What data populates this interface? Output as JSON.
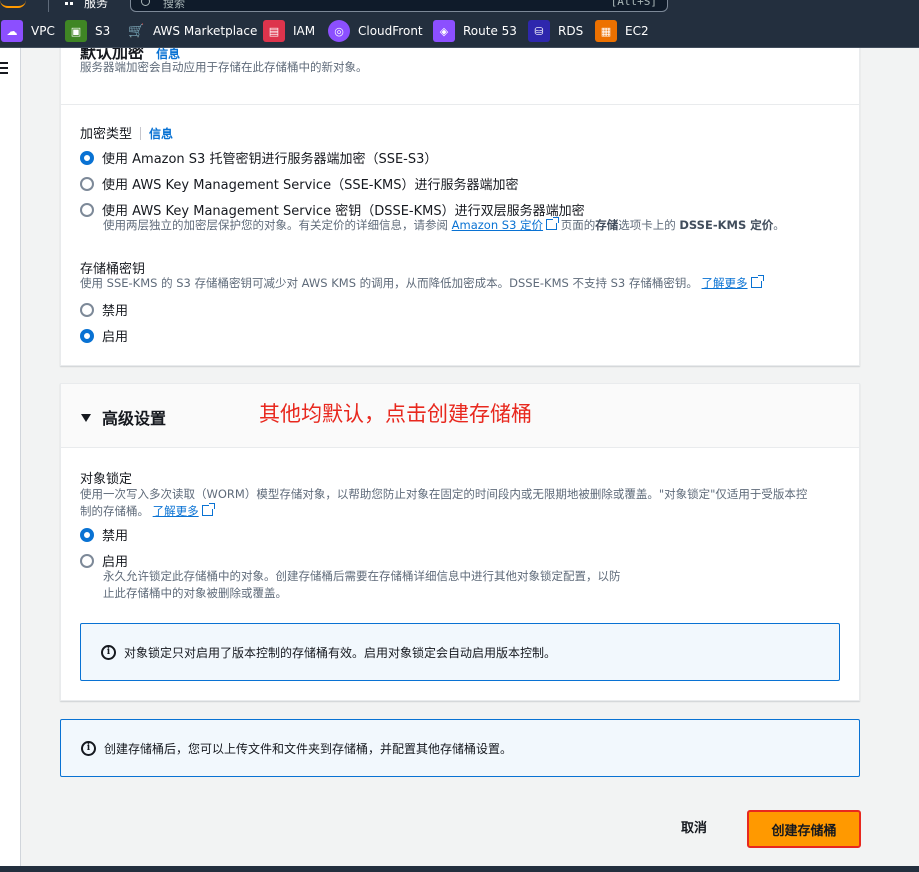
{
  "topbar": {
    "services_label": "服务",
    "search_placeholder": "搜索",
    "search_shortcut": "[Alt+S]"
  },
  "favorites": [
    {
      "label": "VPC",
      "icon": "vpc-icon",
      "color": "#8c4fff"
    },
    {
      "label": "S3",
      "icon": "s3-bucket-icon",
      "color": "#3f8624"
    },
    {
      "label": "AWS Marketplace",
      "icon": "marketplace-cart-icon",
      "color": "#232f3e"
    },
    {
      "label": "IAM",
      "icon": "iam-icon",
      "color": "#dd344c"
    },
    {
      "label": "CloudFront",
      "icon": "cloudfront-icon",
      "color": "#8c4fff"
    },
    {
      "label": "Route 53",
      "icon": "route53-icon",
      "color": "#8c4fff"
    },
    {
      "label": "RDS",
      "icon": "rds-icon",
      "color": "#2e27ad"
    },
    {
      "label": "EC2",
      "icon": "ec2-icon",
      "color": "#ed7100"
    }
  ],
  "encryption": {
    "title": "默认加密",
    "info": "信息",
    "description": "服务器端加密会自动应用于存储在此存储桶中的新对象。",
    "type_label": "加密类型",
    "type_info": "信息",
    "options": [
      {
        "label": "使用 Amazon S3 托管密钥进行服务器端加密（SSE-S3）",
        "checked": true
      },
      {
        "label": "使用 AWS Key Management Service（SSE-KMS）进行服务器端加密",
        "checked": false
      },
      {
        "label": "使用 AWS Key Management Service 密钥（DSSE-KMS）进行双层服务器端加密",
        "checked": false
      }
    ],
    "dsse_desc_before": "使用两层独立的加密层保护您的对象。有关定价的详细信息，请参阅 ",
    "dsse_desc_link": "Amazon S3 定价",
    "dsse_desc_mid": " 页面的",
    "dsse_desc_bold1": "存储",
    "dsse_desc_after": "选项卡上的 ",
    "dsse_desc_bold2": "DSSE-KMS 定价",
    "dsse_desc_end": "。",
    "bucket_key_label": "存储桶密钥",
    "bucket_key_desc": "使用 SSE-KMS 的 S3 存储桶密钥可减少对 AWS KMS 的调用，从而降低加密成本。DSSE-KMS 不支持 S3 存储桶密钥。",
    "bucket_key_learn_more": "了解更多",
    "bucket_key_options": [
      {
        "label": "禁用",
        "checked": false
      },
      {
        "label": "启用",
        "checked": true
      }
    ]
  },
  "advanced": {
    "title": "高级设置",
    "annotation": "其他均默认，点击创建存储桶",
    "object_lock_label": "对象锁定",
    "object_lock_desc_line1": "使用一次写入多次读取（WORM）模型存储对象，以帮助您防止对象在固定的时间段内或无限期地被删除或覆盖。\"对象锁定\"仅适用于受版本控",
    "object_lock_desc_line2": "制的存储桶。",
    "object_lock_learn_more": "了解更多",
    "object_lock_options": [
      {
        "label": "禁用",
        "checked": true
      },
      {
        "label": "启用",
        "checked": false
      }
    ],
    "enable_desc_line1": "永久允许锁定此存储桶中的对象。创建存储桶后需要在存储桶详细信息中进行其他对象锁定配置，以防",
    "enable_desc_line2": "止此存储桶中的对象被删除或覆盖。",
    "alert": "对象锁定只对启用了版本控制的存储桶有效。启用对象锁定会自动启用版本控制。"
  },
  "bottom_alert": "创建存储桶后，您可以上传文件和文件夹到存储桶，并配置其他存储桶设置。",
  "actions": {
    "cancel": "取消",
    "create": "创建存储桶"
  }
}
